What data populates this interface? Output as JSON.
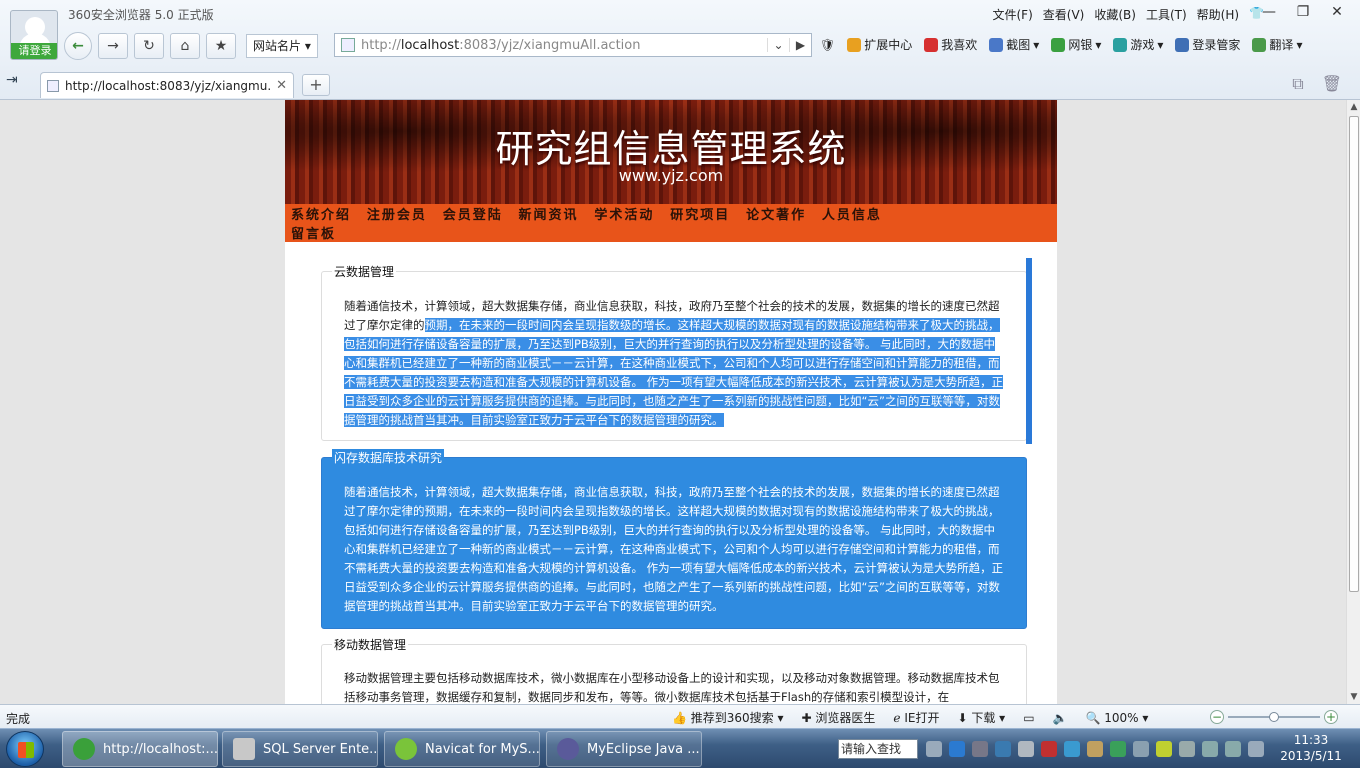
{
  "browser": {
    "app_title": "360安全浏览器 5.0 正式版",
    "login_label": "请登录",
    "menu": [
      "文件(F)",
      "查看(V)",
      "收藏(B)",
      "工具(T)",
      "帮助(H)"
    ],
    "fav_dropdown": "网站名片",
    "address_prefix": "http://",
    "address_host": "localhost",
    "address_rest": ":8083/yjz/xiangmuAll.action",
    "toolbar": [
      "扩展中心",
      "我喜欢",
      "截图",
      "网银",
      "游戏",
      "登录管家",
      "翻译"
    ],
    "tab_title": "http://localhost:8083/yjz/xiangmu...",
    "new_tab": "+"
  },
  "site": {
    "banner_title": "研究组信息管理系统",
    "banner_url": "www.yjz.com",
    "nav": [
      "系统介绍",
      "注册会员",
      "会员登陆",
      "新闻资讯",
      "学术活动",
      "研究项目",
      "论文著作",
      "人员信息",
      "留言板"
    ]
  },
  "sections": [
    {
      "title": "云数据管理",
      "text_plain": "随着通信技术，计算领域，超大数据集存储，商业信息获取，科技，政府乃至整个社会的技术的发展，数据集的增长的速度已然超过了摩尔定律的",
      "text_selected": "预期，在未来的一段时间内会呈现指数级的增长。这样超大规模的数据对现有的数据设施结构带来了极大的挑战，包括如何进行存储设备容量的扩展，乃至达到PB级别，巨大的并行查询的执行以及分析型处理的设备等。 与此同时，大的数据中心和集群机已经建立了一种新的商业模式－－云计算，在这种商业模式下，公司和个人均可以进行存储空间和计算能力的租借，而不需耗费大量的投资要去构造和准备大规模的计算机设备。 作为一项有望大幅降低成本的新兴技术，云计算被认为是大势所趋，正日益受到众多企业的云计算服务提供商的追捧。与此同时，也随之产生了一系列新的挑战性问题，比如“云”之间的互联等等，对数据管理的挑战首当其冲。目前实验室正致力于云平台下的数据管理的研究。"
    },
    {
      "title": "闪存数据库技术研究",
      "text": "随着通信技术，计算领域，超大数据集存储，商业信息获取，科技，政府乃至整个社会的技术的发展，数据集的增长的速度已然超过了摩尔定律的预期，在未来的一段时间内会呈现指数级的增长。这样超大规模的数据对现有的数据设施结构带来了极大的挑战，包括如何进行存储设备容量的扩展，乃至达到PB级别，巨大的并行查询的执行以及分析型处理的设备等。 与此同时，大的数据中心和集群机已经建立了一种新的商业模式－－云计算，在这种商业模式下，公司和个人均可以进行存储空间和计算能力的租借，而不需耗费大量的投资要去构造和准备大规模的计算机设备。 作为一项有望大幅降低成本的新兴技术，云计算被认为是大势所趋，正日益受到众多企业的云计算服务提供商的追捧。与此同时，也随之产生了一系列新的挑战性问题，比如“云”之间的互联等等，对数据管理的挑战首当其冲。目前实验室正致力于云平台下的数据管理的研究。"
    },
    {
      "title": "移动数据管理",
      "text": "移动数据管理主要包括移动数据库技术，微小数据库在小型移动设备上的设计和实现，以及移动对象数据管理。移动数据库技术包括移动事务管理，数据缓存和复制，数据同步和发布，等等。微小数据库技术包括基于Flash的存储和索引模型设计，在"
    }
  ],
  "statusbar": {
    "status": "完成",
    "items": [
      "推荐到360搜索",
      "浏览器医生",
      "IE打开",
      "下载"
    ],
    "zoom": "100%",
    "zoom_fraction": 0.5
  },
  "taskbar": {
    "tasks": [
      "http://localhost:...",
      "SQL Server Ente...",
      "Navicat for MyS...",
      "MyEclipse Java ..."
    ],
    "search_placeholder": "请输入查找",
    "time": "11:33",
    "date": "2013/5/11"
  }
}
